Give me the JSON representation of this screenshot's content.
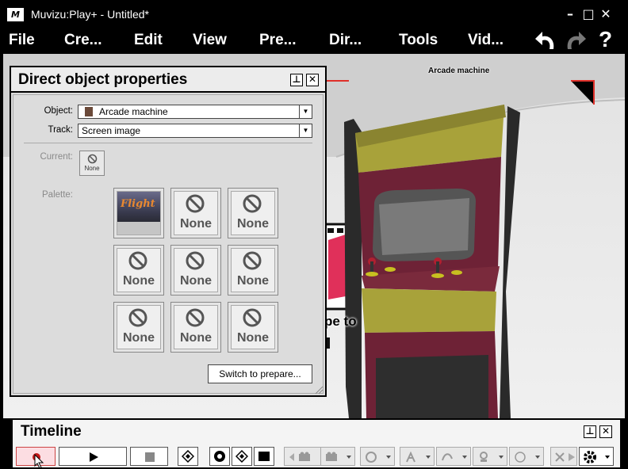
{
  "window": {
    "title": "Muvizu:Play+ - Untitled*",
    "icon_text": "M",
    "minimize": "–",
    "maximize": "□",
    "close": "✕"
  },
  "menu": {
    "items": [
      "File",
      "Cre...",
      "Edit",
      "View",
      "Pre...",
      "Dir...",
      "Tools",
      "Vid..."
    ]
  },
  "toolbar": {
    "undo_icon": "undo-icon",
    "redo_icon": "redo-icon",
    "help_label": "?"
  },
  "scene": {
    "object_label": "Arcade machine",
    "sign_text": "pe to"
  },
  "panel": {
    "title": "Direct object properties",
    "pin": "⊥",
    "close": "✕",
    "object_label": "Object:",
    "object_value": "Arcade machine",
    "track_label": "Track:",
    "track_value": "Screen image",
    "current_label": "Current:",
    "current_value": "None",
    "palette_label": "Palette:",
    "palette": [
      {
        "type": "image",
        "label": "Flight"
      },
      {
        "type": "none",
        "label": "None"
      },
      {
        "type": "none",
        "label": "None"
      },
      {
        "type": "none",
        "label": "None"
      },
      {
        "type": "none",
        "label": "None"
      },
      {
        "type": "none",
        "label": "None"
      },
      {
        "type": "none",
        "label": "None"
      },
      {
        "type": "none",
        "label": "None"
      },
      {
        "type": "none",
        "label": "None"
      }
    ],
    "switch_button": "Switch to prepare..."
  },
  "timeline": {
    "title": "Timeline",
    "pin": "⊥",
    "close": "✕"
  },
  "colors": {
    "accent_red": "#e0302a",
    "cabinet_yellow": "#a8a23a",
    "cabinet_red": "#6e2236"
  }
}
